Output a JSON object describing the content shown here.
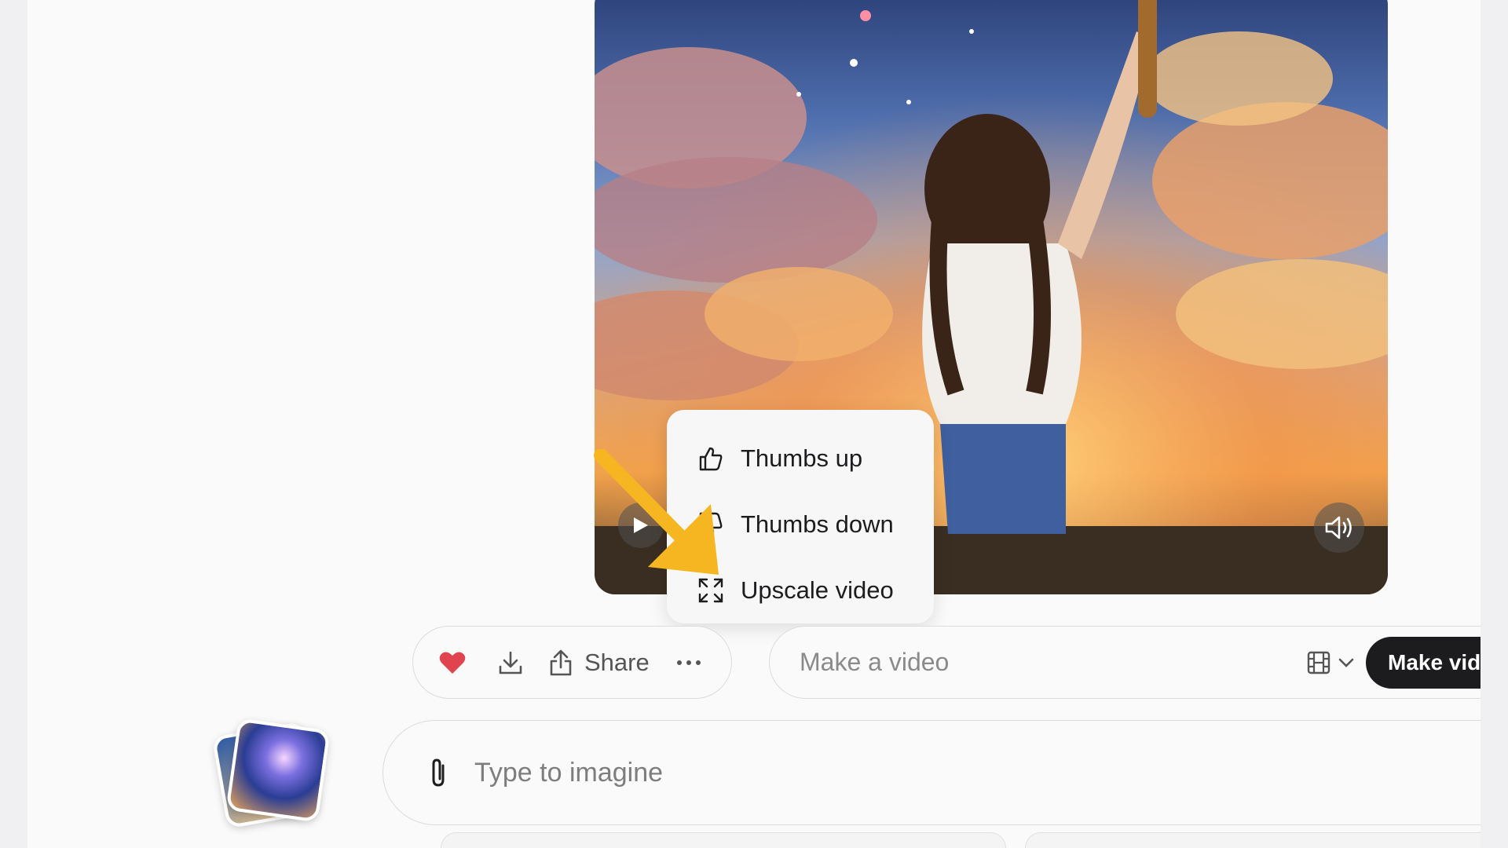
{
  "context_menu": {
    "items": [
      {
        "label": "Thumbs up",
        "icon": "thumbs-up-icon"
      },
      {
        "label": "Thumbs down",
        "icon": "thumbs-down-icon"
      },
      {
        "label": "Upscale video",
        "icon": "expand-icon"
      }
    ]
  },
  "actions": {
    "share_label": "Share",
    "heart_color": "#e0454f"
  },
  "video_prompt": {
    "placeholder": "Make a video",
    "button_label": "Make video"
  },
  "imagine": {
    "placeholder": "Type to imagine"
  },
  "colors": {
    "annotation_arrow": "#f5b621",
    "button_dark": "#1c1c1e"
  }
}
